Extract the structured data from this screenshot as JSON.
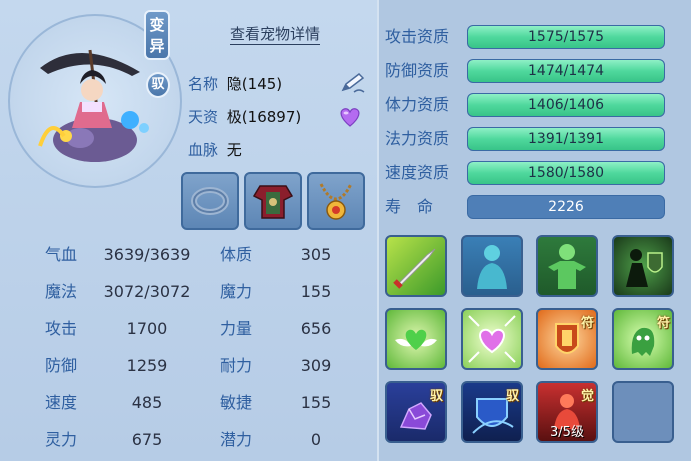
{
  "header": {
    "detail_link": "查看宠物详情",
    "badge_mutation": "变\n异",
    "badge_ride": "驭"
  },
  "info": {
    "name_label": "名称",
    "name_value": "隐(145)",
    "aptitude_label": "天资",
    "aptitude_value": "极(16897)",
    "blood_label": "血脉",
    "blood_value": "无"
  },
  "stats": [
    {
      "label1": "气血",
      "value1": "3639/3639",
      "label2": "体质",
      "value2": "305"
    },
    {
      "label1": "魔法",
      "value1": "3072/3072",
      "label2": "魔力",
      "value2": "155"
    },
    {
      "label1": "攻击",
      "value1": "1700",
      "label2": "力量",
      "value2": "656"
    },
    {
      "label1": "防御",
      "value1": "1259",
      "label2": "耐力",
      "value2": "309"
    },
    {
      "label1": "速度",
      "value1": "485",
      "label2": "敏捷",
      "value2": "155"
    },
    {
      "label1": "灵力",
      "value1": "675",
      "label2": "潜力",
      "value2": "0"
    }
  ],
  "aptitudes": [
    {
      "label": "攻击资质",
      "value": "1575/1575",
      "fill": 1.0
    },
    {
      "label": "防御资质",
      "value": "1474/1474",
      "fill": 1.0
    },
    {
      "label": "体力资质",
      "value": "1406/1406",
      "fill": 1.0
    },
    {
      "label": "法力资质",
      "value": "1391/1391",
      "fill": 1.0
    },
    {
      "label": "速度资质",
      "value": "1580/1580",
      "fill": 1.0
    }
  ],
  "life": {
    "label": "寿　命",
    "value": "2226"
  },
  "skills": [
    {
      "icon": "sword-icon",
      "tag": "",
      "level": ""
    },
    {
      "icon": "spirit-figure-icon",
      "tag": "",
      "level": ""
    },
    {
      "icon": "green-figure-icon",
      "tag": "",
      "level": ""
    },
    {
      "icon": "shield-warrior-icon",
      "tag": "",
      "level": ""
    },
    {
      "icon": "winged-heart-icon",
      "tag": "",
      "level": ""
    },
    {
      "icon": "sparkle-heart-icon",
      "tag": "",
      "level": ""
    },
    {
      "icon": "talisman-shield-icon",
      "tag": "符",
      "level": ""
    },
    {
      "icon": "talisman-ghost-icon",
      "tag": "符",
      "level": ""
    },
    {
      "icon": "purple-crystal-icon",
      "tag": "驭",
      "level": ""
    },
    {
      "icon": "blue-shield-icon",
      "tag": "驭",
      "level": ""
    },
    {
      "icon": "awaken-figure-icon",
      "tag": "觉",
      "level": "3/5级"
    },
    {
      "icon": "empty-slot",
      "tag": "",
      "level": ""
    }
  ],
  "colors": {
    "label_blue": "#2f5fa0",
    "bar_green": "#4fd89d",
    "bar_blue": "#4f7fb7",
    "panel_bg": "#b9cfe6"
  }
}
